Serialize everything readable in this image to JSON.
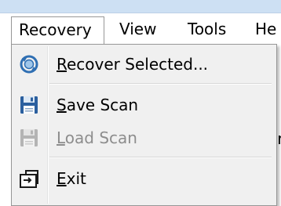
{
  "menubar": {
    "items": [
      {
        "label": "Recovery",
        "active": true
      },
      {
        "label": "View"
      },
      {
        "label": "Tools"
      },
      {
        "label": "He"
      }
    ]
  },
  "dropdown": {
    "items": [
      {
        "mnemonic": "R",
        "rest": "ecover Selected...",
        "icon": "recover-icon",
        "enabled": true
      },
      {
        "mnemonic": "S",
        "rest": "ave Scan",
        "icon": "save-scan-icon",
        "enabled": true
      },
      {
        "mnemonic": "L",
        "rest": "oad Scan",
        "icon": "load-scan-icon",
        "enabled": false
      },
      {
        "mnemonic": "E",
        "rest": "xit",
        "icon": "exit-icon",
        "enabled": true
      }
    ]
  },
  "background": {
    "partial_text": "ar"
  },
  "colors": {
    "menu_bg": "#f0f0f0",
    "border": "#979797",
    "disabled_text": "#8d8d8d",
    "icon_blue": "#2f6fb3"
  }
}
